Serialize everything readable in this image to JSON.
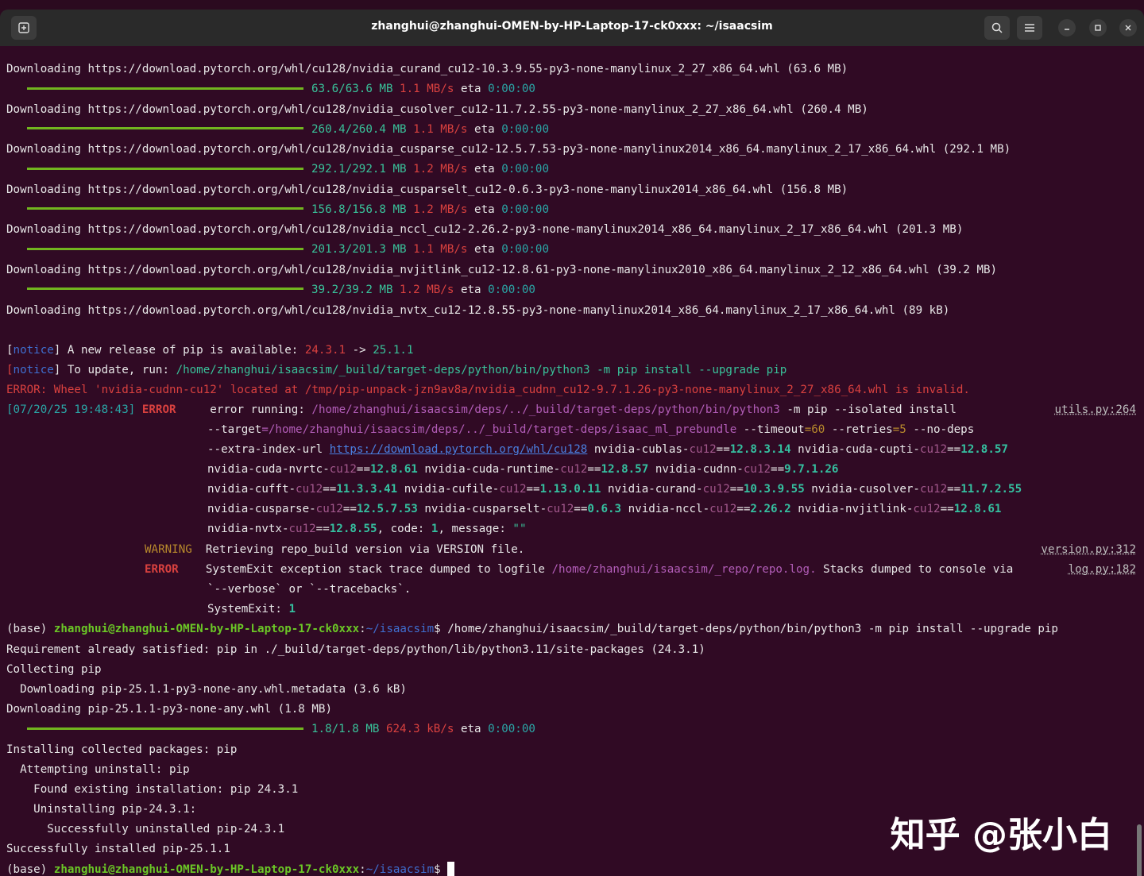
{
  "window": {
    "title": "zhanghui@zhanghui-OMEN-by-HP-Laptop-17-ck0xxx: ~/isaacsim"
  },
  "downloads": [
    {
      "url": "Downloading https://download.pytorch.org/whl/cu128/nvidia_curand_cu12-10.3.9.55-py3-none-manylinux_2_27_x86_64.whl (63.6 MB)",
      "size": "63.6/63.6 MB",
      "speed": "1.1 MB/s",
      "eta": "0:00:00"
    },
    {
      "url": "Downloading https://download.pytorch.org/whl/cu128/nvidia_cusolver_cu12-11.7.2.55-py3-none-manylinux_2_27_x86_64.whl (260.4 MB)",
      "size": "260.4/260.4 MB",
      "speed": "1.1 MB/s",
      "eta": "0:00:00"
    },
    {
      "url": "Downloading https://download.pytorch.org/whl/cu128/nvidia_cusparse_cu12-12.5.7.53-py3-none-manylinux2014_x86_64.manylinux_2_17_x86_64.whl (292.1 MB)",
      "size": "292.1/292.1 MB",
      "speed": "1.2 MB/s",
      "eta": "0:00:00"
    },
    {
      "url": "Downloading https://download.pytorch.org/whl/cu128/nvidia_cusparselt_cu12-0.6.3-py3-none-manylinux2014_x86_64.whl (156.8 MB)",
      "size": "156.8/156.8 MB",
      "speed": "1.2 MB/s",
      "eta": "0:00:00"
    },
    {
      "url": "Downloading https://download.pytorch.org/whl/cu128/nvidia_nccl_cu12-2.26.2-py3-none-manylinux2014_x86_64.manylinux_2_17_x86_64.whl (201.3 MB)",
      "size": "201.3/201.3 MB",
      "speed": "1.1 MB/s",
      "eta": "0:00:00"
    },
    {
      "url": "Downloading https://download.pytorch.org/whl/cu128/nvidia_nvjitlink_cu12-12.8.61-py3-none-manylinux2010_x86_64.manylinux_2_12_x86_64.whl (39.2 MB)",
      "size": "39.2/39.2 MB",
      "speed": "1.2 MB/s",
      "eta": "0:00:00"
    }
  ],
  "last_download": "Downloading https://download.pytorch.org/whl/cu128/nvidia_nvtx_cu12-12.8.55-py3-none-manylinux2014_x86_64.manylinux_2_17_x86_64.whl (89 kB)",
  "notice": {
    "tag": "notice",
    "l1_text": " A new release of pip is available: ",
    "old_ver": "24.3.1",
    "arrow": " -> ",
    "new_ver": "25.1.1",
    "l2_text": " To update, run: ",
    "l2_cmd": "/home/zhanghui/isaacsim/_build/target-deps/python/bin/python3 -m pip install --upgrade pip"
  },
  "error_line": "ERROR: Wheel 'nvidia-cudnn-cu12' located at /tmp/pip-unpack-jzn9av8a/nvidia_cudnn_cu12-9.7.1.26-py3-none-manylinux_2_27_x86_64.whl is invalid.",
  "log": {
    "timestamp": "[07/20/25 19:48:43]",
    "level_error": "ERROR",
    "level_warning": "WARNING",
    "src1": "utils.py:264",
    "src2": "version.py:312",
    "src3": "log.py:182",
    "err_running": "error running: ",
    "python_path": "/home/zhanghui/isaacsim/deps/../_build/target-deps/python/bin/python3",
    "pip_args": " -m pip --isolated install",
    "target_flag": "--target",
    "target_path": "=/home/zhanghui/isaacsim/deps/../_build/target-deps/isaac_ml_prebundle",
    "timeout_flag": " --timeout",
    "timeout_val": "=60",
    "retries_flag": " --retries",
    "retries_val": "=5",
    "nodeps": " --no-deps",
    "extra_index": "--extra-index-url ",
    "index_url": "https://download.pytorch.org/whl/cu128",
    "code_text": ", code: ",
    "code_val": "1",
    "message_text": ", message: ",
    "message_val": "\"\"",
    "warning_msg": "Retrieving repo_build version via VERSION file.",
    "sysexit_1": "SystemExit exception stack trace dumped to logfile ",
    "logfile": "/home/zhanghui/isaacsim/_repo/repo.log.",
    "sysexit_2": " Stacks dumped to console via",
    "sysexit_3": "`--verbose` or `--tracebacks`.",
    "sysexit_4": "SystemExit: ",
    "sysexit_val": "1"
  },
  "packages": [
    [
      [
        "nvidia-cublas",
        "12.8.3.14"
      ],
      [
        "nvidia-cuda-cupti",
        "12.8.57"
      ]
    ],
    [
      [
        "nvidia-cuda-nvrtc",
        "12.8.61"
      ],
      [
        "nvidia-cuda-runtime",
        "12.8.57"
      ],
      [
        "nvidia-cudnn",
        "9.7.1.26"
      ]
    ],
    [
      [
        "nvidia-cufft",
        "11.3.3.41"
      ],
      [
        "nvidia-cufile",
        "1.13.0.11"
      ],
      [
        "nvidia-curand",
        "10.3.9.55"
      ],
      [
        "nvidia-cusolver",
        "11.7.2.55"
      ]
    ],
    [
      [
        "nvidia-cusparse",
        "12.5.7.53"
      ],
      [
        "nvidia-cusparselt",
        "0.6.3"
      ],
      [
        "nvidia-nccl",
        "2.26.2"
      ],
      [
        "nvidia-nvjitlink",
        "12.8.61"
      ]
    ],
    [
      [
        "nvidia-nvtx",
        "12.8.55"
      ]
    ]
  ],
  "pkg_suffix": "cu12",
  "pkg_eq": "==",
  "prompt": {
    "env": "(base) ",
    "user": "zhanghui@zhanghui-OMEN-by-HP-Laptop-17-ck0xxx",
    "colon": ":",
    "path": "~/isaacsim",
    "dollar": "$ "
  },
  "command": "/home/zhanghui/isaacsim/_build/target-deps/python/bin/python3 -m pip install --upgrade pip",
  "output": [
    "Requirement already satisfied: pip in ./_build/target-deps/python/lib/python3.11/site-packages (24.3.1)",
    "Collecting pip",
    "  Downloading pip-25.1.1-py3-none-any.whl.metadata (3.6 kB)",
    "Downloading pip-25.1.1-py3-none-any.whl (1.8 MB)"
  ],
  "pip_progress": {
    "size": "1.8/1.8 MB",
    "speed": "624.3 kB/s",
    "eta": "0:00:00",
    "eta_label": "eta"
  },
  "output2": [
    "Installing collected packages: pip",
    "  Attempting uninstall: pip",
    "    Found existing installation: pip 24.3.1",
    "    Uninstalling pip-24.3.1:",
    "      Successfully uninstalled pip-24.3.1",
    "Successfully installed pip-25.1.1"
  ],
  "watermark": "知乎 @张小白",
  "icons": {
    "new_tab": "new-tab-icon",
    "search": "search-icon",
    "menu": "hamburger-menu-icon",
    "minimize": "minimize-icon",
    "maximize": "maximize-icon",
    "close": "close-icon"
  }
}
